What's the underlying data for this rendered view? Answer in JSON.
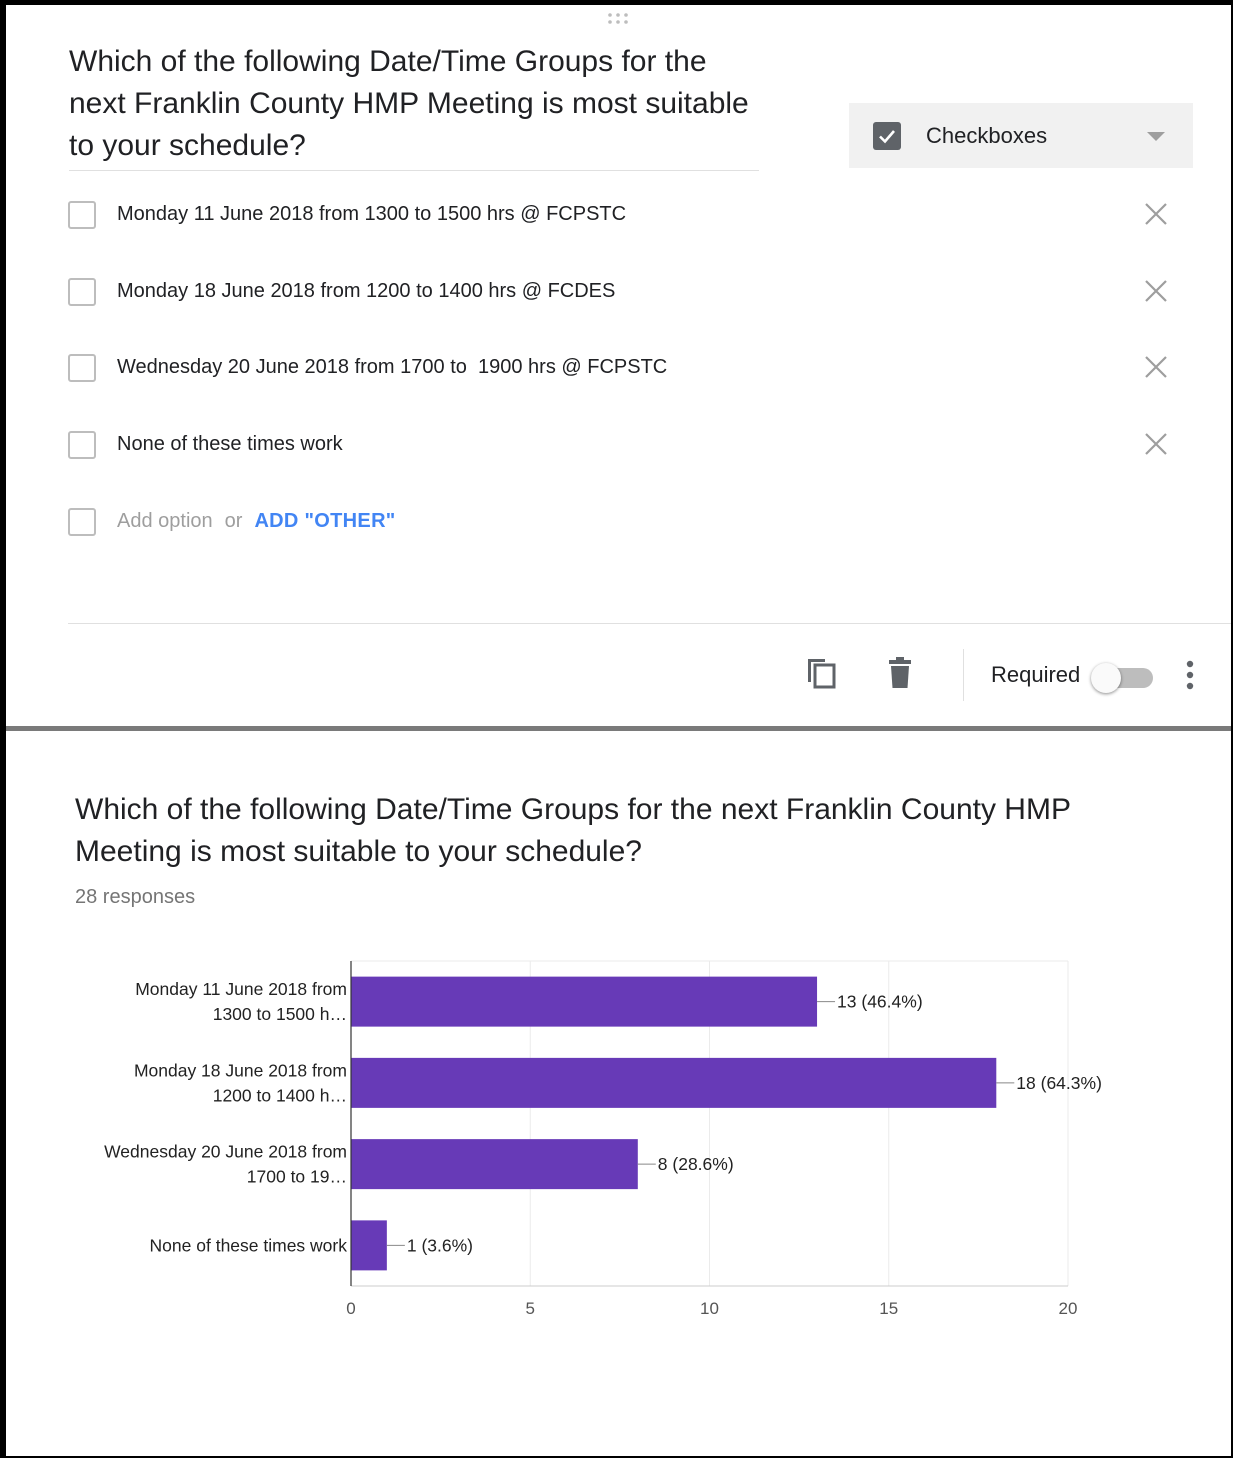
{
  "editor": {
    "question_title": "Which of the following Date/Time Groups for the next Franklin County HMP Meeting is most suitable to your schedule?",
    "question_type": "Checkboxes",
    "options": [
      "Monday 11 June 2018 from 1300 to 1500 hrs @ FCPSTC",
      "Monday 18 June 2018 from 1200 to 1400 hrs @ FCDES",
      "Wednesday 20 June 2018 from 1700 to  1900 hrs @ FCPSTC",
      "None of these times work"
    ],
    "add_option_placeholder": "Add option",
    "add_or": "or",
    "add_other_label": "ADD \"OTHER\"",
    "required_label": "Required",
    "required": false,
    "icons": {
      "drag": "drag-handle-icon",
      "type": "checkbox-checked-icon",
      "remove": "close-icon",
      "duplicate": "copy-icon",
      "delete": "trash-icon",
      "more": "more-vert-icon"
    }
  },
  "summary": {
    "question_title": "Which of the following Date/Time Groups for the next Franklin County HMP Meeting is most suitable to your schedule?",
    "response_count": "28 responses"
  },
  "chart_data": {
    "type": "bar",
    "orientation": "horizontal",
    "categories": [
      [
        "Monday 11 June 2018 from",
        "1300 to 1500 h…"
      ],
      [
        "Monday 18 June 2018 from",
        "1200 to 1400 h…"
      ],
      [
        "Wednesday 20 June 2018 from",
        "1700 to 19…"
      ],
      [
        "None of these times work"
      ]
    ],
    "values": [
      13,
      18,
      8,
      1
    ],
    "value_labels": [
      "13 (46.4%)",
      "18 (64.3%)",
      "8 (28.6%)",
      "1 (3.6%)"
    ],
    "xlim": [
      0,
      20
    ],
    "xticks": [
      0,
      5,
      10,
      15,
      20
    ],
    "grid": true,
    "bar_color": "#673ab7",
    "grid_color": "#ebebeb"
  }
}
